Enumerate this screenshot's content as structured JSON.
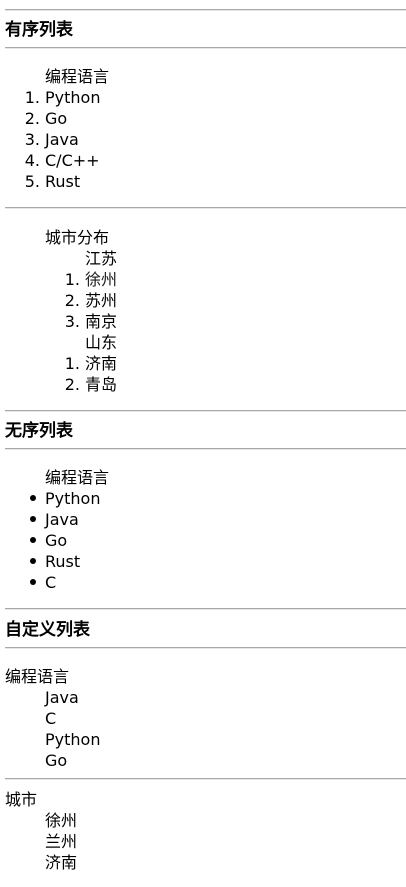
{
  "sections": {
    "ordered": "有序列表",
    "unordered": "无序列表",
    "definition": "自定义列表"
  },
  "ordered_list": {
    "caption": "编程语言",
    "items": [
      "Python",
      "Go",
      "Java",
      "C/C++",
      "Rust"
    ]
  },
  "city_list": {
    "caption": "城市分布",
    "groups": [
      {
        "name": "江苏",
        "items": [
          "徐州",
          "苏州",
          "南京"
        ]
      },
      {
        "name": "山东",
        "items": [
          "济南",
          "青岛"
        ]
      }
    ]
  },
  "unordered_list": {
    "caption": "编程语言",
    "items": [
      "Python",
      "Java",
      "Go",
      "Rust",
      "C"
    ]
  },
  "definition_lists": [
    {
      "term": "编程语言",
      "items": [
        "Java",
        "C",
        "Python",
        "Go"
      ]
    },
    {
      "term": "城市",
      "items": [
        "徐州",
        "兰州",
        "济南"
      ]
    }
  ]
}
